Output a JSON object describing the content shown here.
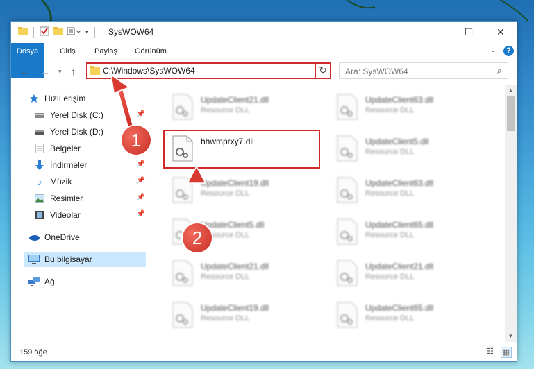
{
  "window": {
    "title": "SysWOW64"
  },
  "ribbon": {
    "tabs": [
      "Dosya",
      "Giriş",
      "Paylaş",
      "Görünüm"
    ]
  },
  "address": {
    "path": "C:\\Windows\\SysWOW64"
  },
  "search": {
    "placeholder": "Ara: SysWOW64"
  },
  "sidebar": {
    "items": [
      {
        "label": "Hızlı erişim",
        "icon": "star-icon"
      },
      {
        "label": "Yerel Disk (C:)",
        "icon": "drive-icon",
        "pinned": true
      },
      {
        "label": "Yerel Disk (D:)",
        "icon": "drive-icon"
      },
      {
        "label": "Belgeler",
        "icon": "documents-icon",
        "pinned": true
      },
      {
        "label": "İndirmeler",
        "icon": "download-icon",
        "pinned": true
      },
      {
        "label": "Müzik",
        "icon": "music-icon",
        "pinned": true
      },
      {
        "label": "Resimler",
        "icon": "pictures-icon",
        "pinned": true
      },
      {
        "label": "Videolar",
        "icon": "videos-icon",
        "pinned": true
      },
      {
        "label": "OneDrive",
        "icon": "cloud-icon"
      },
      {
        "label": "Bu bilgisayar",
        "icon": "computer-icon",
        "selected": true
      },
      {
        "label": "Ağ",
        "icon": "network-icon"
      }
    ]
  },
  "files": [
    {
      "name": "UpdateClient21.dll",
      "type": "Resource DLL"
    },
    {
      "name": "UpdateClient63.dll",
      "type": "Resource DLL"
    },
    {
      "name": "hhwmprxy7.dll",
      "type": ""
    },
    {
      "name": "UpdateClient5.dll",
      "type": "Resource DLL"
    },
    {
      "name": "UpdateClient19.dll",
      "type": "Resource DLL"
    },
    {
      "name": "UpdateClient63.dll",
      "type": "Resource DLL"
    },
    {
      "name": "UpdateClient5.dll",
      "type": "Resource DLL"
    },
    {
      "name": "UpdateClient65.dll",
      "type": "Resource DLL"
    },
    {
      "name": "UpdateClient21.dll",
      "type": "Resource DLL"
    },
    {
      "name": "UpdateClient21.dll",
      "type": "Resource DLL"
    },
    {
      "name": "UpdateClient19.dll",
      "type": "Resource DLL"
    },
    {
      "name": "UpdateClient65.dll",
      "type": "Resource DLL"
    }
  ],
  "status": {
    "count": "159 öğe"
  },
  "annotations": {
    "step1": "1",
    "step2": "2"
  },
  "colors": {
    "accent": "#1979ca",
    "highlight": "#d22a2a",
    "selected": "#cce8ff"
  }
}
